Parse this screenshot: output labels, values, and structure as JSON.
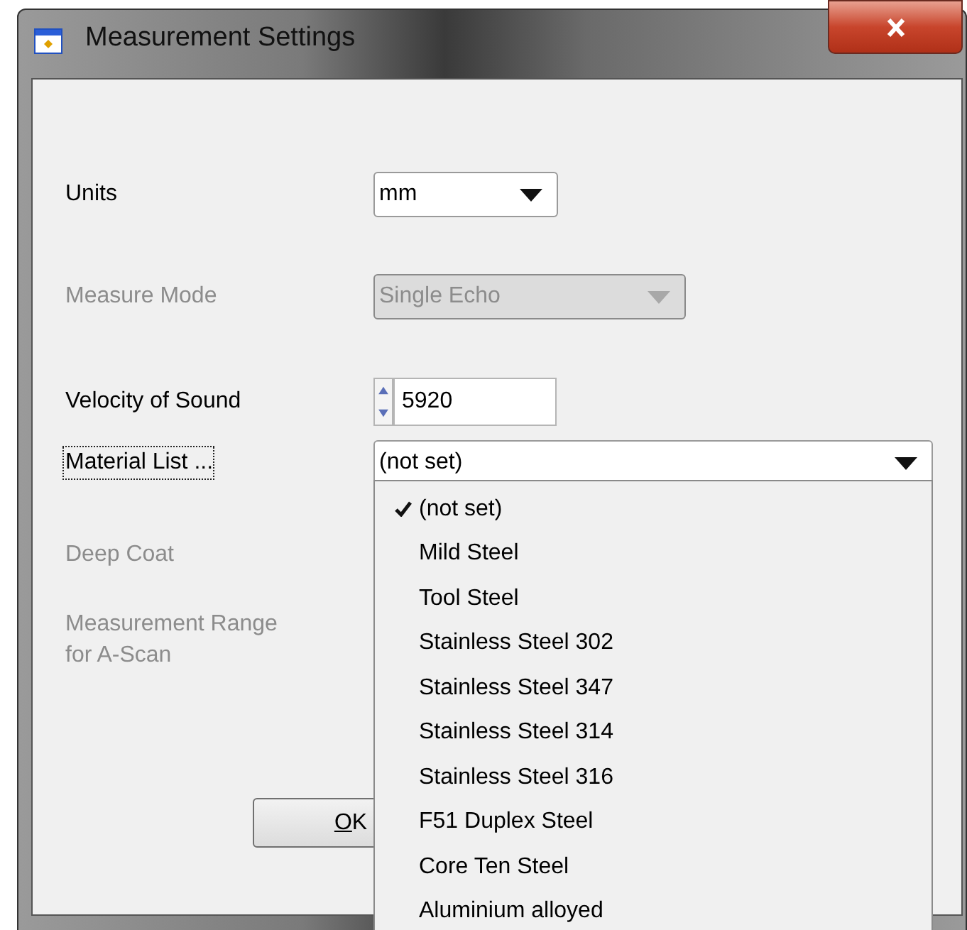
{
  "window": {
    "title": "Measurement Settings"
  },
  "fields": [
    {
      "label": "Units",
      "kind": "dropdown",
      "value": "mm",
      "disabled": false,
      "focused": false
    },
    {
      "label": "Measure Mode",
      "kind": "dropdown",
      "value": "Single Echo",
      "disabled": true,
      "focused": false
    },
    {
      "label": "Velocity of Sound",
      "kind": "spinner",
      "value": "5920",
      "disabled": false,
      "focused": false
    },
    {
      "label": "Material List ...",
      "kind": "combo",
      "value": "(not set)",
      "disabled": false,
      "focused": true
    },
    {
      "label": "Deep Coat",
      "kind": "none",
      "disabled": true,
      "focused": false
    },
    {
      "label": "Measurement Range for A-Scan",
      "kind": "none",
      "disabled": true,
      "focused": false
    }
  ],
  "buttons": [
    {
      "label": "OK"
    }
  ],
  "material_menu": {
    "items": [
      {
        "label": "(not set)",
        "selected": true
      },
      {
        "label": "Mild Steel",
        "selected": false
      },
      {
        "label": "Tool Steel",
        "selected": false
      },
      {
        "label": "Stainless Steel 302",
        "selected": false
      },
      {
        "label": "Stainless Steel 347",
        "selected": false
      },
      {
        "label": "Stainless Steel 314",
        "selected": false
      },
      {
        "label": "Stainless Steel 316",
        "selected": false
      },
      {
        "label": "F51 Duplex Steel",
        "selected": false
      },
      {
        "label": "Core Ten Steel",
        "selected": false
      },
      {
        "label": "Aluminium alloyed",
        "selected": false
      }
    ]
  }
}
